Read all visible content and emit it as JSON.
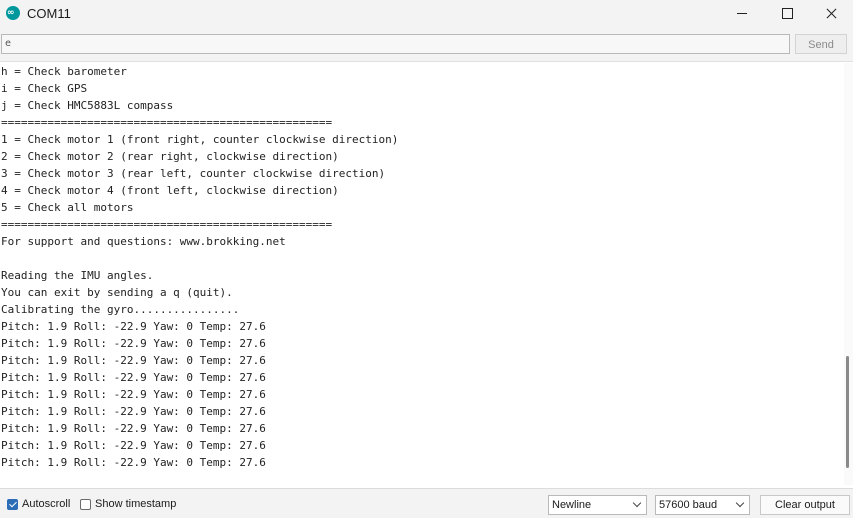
{
  "window": {
    "title": "COM11",
    "app_icon": "arduino-icon",
    "app_icon_glyph": "∞"
  },
  "send": {
    "input_value": "e",
    "button_label": "Send"
  },
  "output": {
    "lines": [
      "h = Check barometer",
      "i = Check GPS",
      "j = Check HMC5883L compass",
      "==================================================",
      "1 = Check motor 1 (front right, counter clockwise direction)",
      "2 = Check motor 2 (rear right, clockwise direction)",
      "3 = Check motor 3 (rear left, counter clockwise direction)",
      "4 = Check motor 4 (front left, clockwise direction)",
      "5 = Check all motors",
      "==================================================",
      "For support and questions: www.brokking.net",
      "",
      "Reading the IMU angles.",
      "You can exit by sending a q (quit).",
      "Calibrating the gyro................",
      "Pitch: 1.9 Roll: -22.9 Yaw: 0 Temp: 27.6",
      "Pitch: 1.9 Roll: -22.9 Yaw: 0 Temp: 27.6",
      "Pitch: 1.9 Roll: -22.9 Yaw: 0 Temp: 27.6",
      "Pitch: 1.9 Roll: -22.9 Yaw: 0 Temp: 27.6",
      "Pitch: 1.9 Roll: -22.9 Yaw: 0 Temp: 27.6",
      "Pitch: 1.9 Roll: -22.9 Yaw: 0 Temp: 27.6",
      "Pitch: 1.9 Roll: -22.9 Yaw: 0 Temp: 27.6",
      "Pitch: 1.9 Roll: -22.9 Yaw: 0 Temp: 27.6",
      "Pitch: 1.9 Roll: -22.9 Yaw: 0 Temp: 27.6"
    ]
  },
  "footer": {
    "autoscroll_label": "Autoscroll",
    "autoscroll_checked": true,
    "timestamp_label": "Show timestamp",
    "timestamp_checked": false,
    "line_ending": "Newline",
    "baud_rate": "57600 baud",
    "clear_label": "Clear output"
  },
  "colors": {
    "accent": "#2c6db5",
    "arduino_teal": "#00979d"
  }
}
